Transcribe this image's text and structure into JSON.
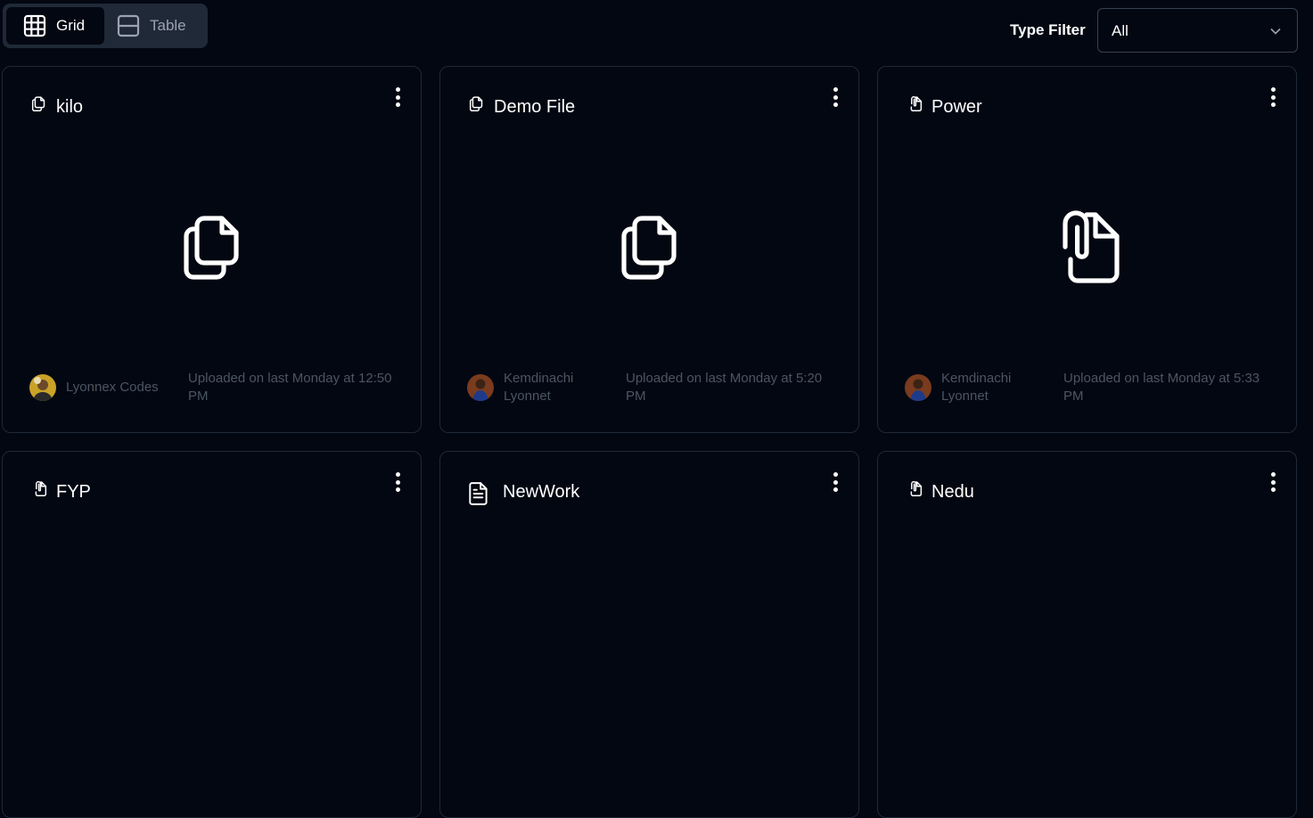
{
  "view_toggle": {
    "grid_label": "Grid",
    "table_label": "Table",
    "active": "grid"
  },
  "type_filter": {
    "label": "Type Filter",
    "selected": "All"
  },
  "colors": {
    "background": "#030712",
    "card_border": "#1f2937",
    "muted_text": "#4b5563",
    "toggle_bg": "#1f2937"
  },
  "files": [
    {
      "title": "kilo",
      "icon": "files-icon",
      "preview_icon": "files-icon",
      "uploader": "Lyonnex Codes",
      "uploaded": "Uploaded on last Monday at 12:50 PM"
    },
    {
      "title": "Demo File",
      "icon": "files-icon",
      "preview_icon": "files-icon",
      "uploader": "Kemdinachi Lyonnet",
      "uploaded": "Uploaded on last Monday at 5:20 PM"
    },
    {
      "title": "Power",
      "icon": "paperclip-file-icon",
      "preview_icon": "paperclip-file-icon",
      "uploader": "Kemdinachi Lyonnet",
      "uploaded": "Uploaded on last Monday at 5:33 PM"
    },
    {
      "title": "FYP",
      "icon": "paperclip-file-icon"
    },
    {
      "title": "NewWork",
      "icon": "document-text-icon"
    },
    {
      "title": "Nedu",
      "icon": "paperclip-file-icon"
    }
  ]
}
